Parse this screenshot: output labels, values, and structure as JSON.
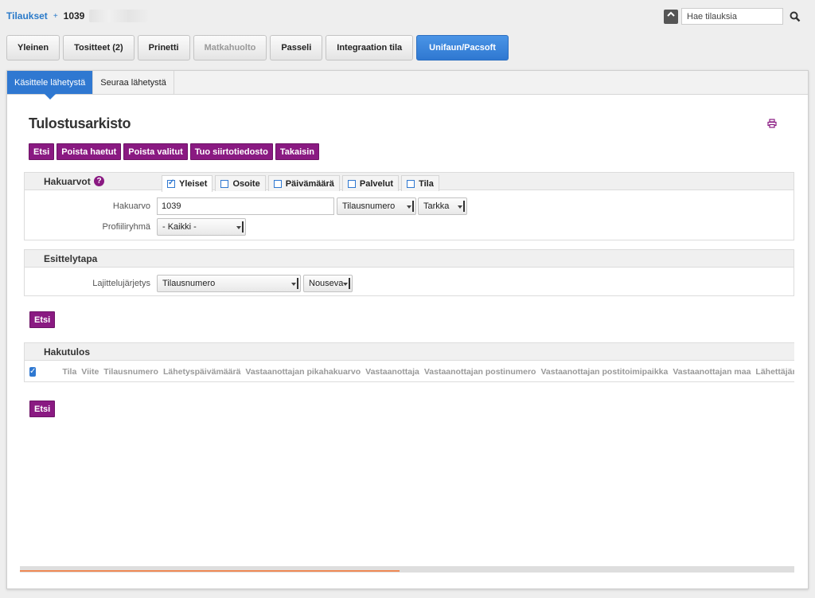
{
  "breadcrumb": {
    "root": "Tilaukset",
    "separator": "+",
    "order": "1039"
  },
  "search": {
    "placeholder": "Hae tilauksia",
    "toggle_icon": "chevron-up-icon",
    "button_icon": "search-icon"
  },
  "main_tabs": [
    {
      "label": "Yleinen",
      "state": "normal"
    },
    {
      "label": "Tositteet (2)",
      "state": "normal"
    },
    {
      "label": "Prinetti",
      "state": "normal"
    },
    {
      "label": "Matkahuolto",
      "state": "disabled"
    },
    {
      "label": "Passeli",
      "state": "normal"
    },
    {
      "label": "Integraation tila",
      "state": "normal"
    },
    {
      "label": "Unifaun/Pacsoft",
      "state": "active"
    }
  ],
  "sub_tabs": [
    {
      "label": "Käsittele lähetystä",
      "active": true
    },
    {
      "label": "Seuraa lähetystä",
      "active": false
    }
  ],
  "page_title": "Tulostusarkisto",
  "print_icon": "print-icon",
  "actions": [
    "Etsi",
    "Poista haetut",
    "Poista valitut",
    "Tuo siirtotiedosto",
    "Takaisin"
  ],
  "search_values": {
    "title": "Hakuarvot",
    "help_icon": "?",
    "filter_tabs": [
      {
        "label": "Yleiset",
        "checked": true
      },
      {
        "label": "Osoite",
        "checked": false
      },
      {
        "label": "Päivämäärä",
        "checked": false
      },
      {
        "label": "Palvelut",
        "checked": false
      },
      {
        "label": "Tila",
        "checked": false
      }
    ],
    "search_label": "Hakuarvo",
    "search_value": "1039",
    "field_select": "Tilausnumero",
    "match_select": "Tarkka",
    "profile_label": "Profiiliryhmä",
    "profile_select": "- Kaikki -"
  },
  "display": {
    "title": "Esittelytapa",
    "sort_label": "Lajittelujärjetys",
    "sort_select": "Tilausnumero",
    "order_select": "Nouseva"
  },
  "search_button": "Etsi",
  "results": {
    "title": "Hakutulos",
    "select_all_checked": true,
    "columns": [
      "Tila",
      "Viite",
      "Tilausnumero",
      "Lähetyspäivämäärä",
      "Vastaanottajan pikahakuarvo",
      "Vastaanottaja",
      "Vastaanottajan postinumero",
      "Vastaanottajan postitoimipaikka",
      "Vastaanottajan maa",
      "Lähettäjän pikahak"
    ]
  },
  "bottom_search_button": "Etsi",
  "progress": {
    "value": 0.49
  },
  "colors": {
    "accent": "#2f78d1",
    "action": "#8a1a82",
    "progress": "#f08a55"
  }
}
